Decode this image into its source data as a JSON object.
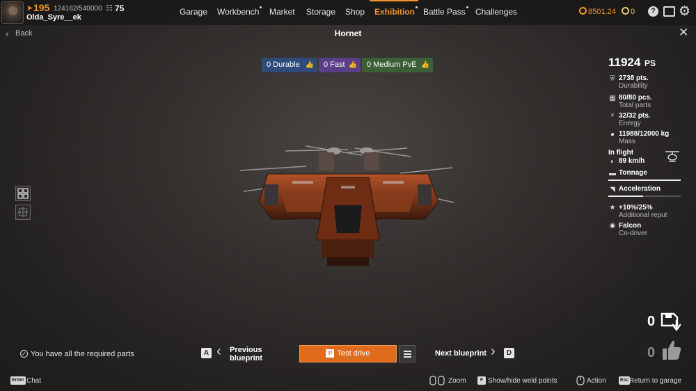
{
  "player": {
    "level": "195",
    "xp": "124182/540000",
    "prestige": "75",
    "name": "Olda_Syre__ek"
  },
  "nav": [
    {
      "label": "Garage",
      "dot": false,
      "active": false
    },
    {
      "label": "Workbench",
      "dot": true,
      "active": false
    },
    {
      "label": "Market",
      "dot": false,
      "active": false
    },
    {
      "label": "Storage",
      "dot": false,
      "active": false
    },
    {
      "label": "Shop",
      "dot": false,
      "active": false
    },
    {
      "label": "Exhibition",
      "dot": true,
      "active": true
    },
    {
      "label": "Battle Pass",
      "dot": true,
      "active": false
    },
    {
      "label": "Challenges",
      "dot": false,
      "active": false
    }
  ],
  "currency": {
    "coins": "8501.24",
    "badges": "0"
  },
  "header": {
    "back_label": "Back",
    "title": "Hornet"
  },
  "tags": [
    {
      "label": "0 Durable",
      "color": "#2e4a78"
    },
    {
      "label": "0 Fast",
      "color": "#5a3f86"
    },
    {
      "label": "0 Medium PvE",
      "color": "#3c5f36"
    }
  ],
  "stats": {
    "power_score": "11924",
    "power_unit": "PS",
    "durability_value": "2738 pts.",
    "durability_label": "Durability",
    "parts_value": "80/80 pcs.",
    "parts_label": "Total parts",
    "energy_value": "32/32 pts.",
    "energy_label": "Energy",
    "mass_value": "11988/12000 kg",
    "mass_label": "Mass",
    "in_flight_label": "In flight",
    "speed_value": "89 km/h",
    "tonnage_label": "Tonnage",
    "tonnage_level": 1.0,
    "acceleration_label": "Acceleration",
    "acceleration_level": 0.48,
    "reputation_value": "+10%/25%",
    "reputation_label": "Additional reput",
    "codriver_value": "Falcon",
    "codriver_label": "Co-driver"
  },
  "bottom": {
    "requirements_text": "You have all the required parts",
    "prev_key": "A",
    "prev_label": "Previous blueprint",
    "test_drive_key": "P",
    "test_drive_label": "Test drive",
    "next_label": "Next blueprint",
    "next_key": "D",
    "saves_count": "0",
    "likes_count": "0"
  },
  "footer": {
    "chat_key": "Enter",
    "chat_label": "Chat",
    "zoom_label": "Zoom",
    "weld_key": "F",
    "weld_label": "Show/hide weld points",
    "action_label": "Action",
    "return_key": "Esc",
    "return_label": "Return to garage"
  },
  "colors": {
    "accent": "#f2942d",
    "button": "#e06b1d"
  }
}
